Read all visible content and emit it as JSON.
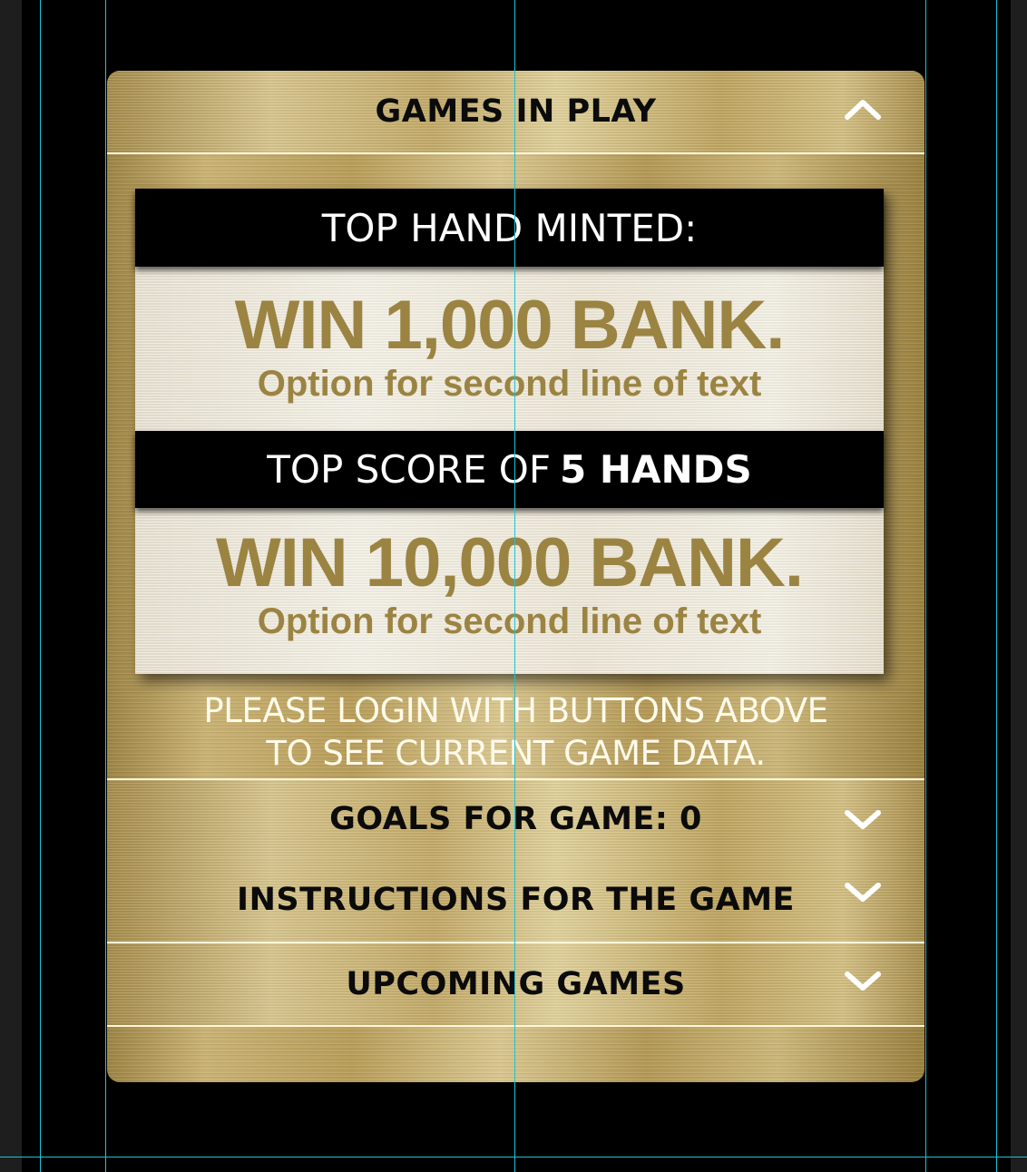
{
  "panel": {
    "header": {
      "title": "GAMES IN PLAY",
      "state": "expanded"
    },
    "prizes": [
      {
        "band_label": "TOP HAND MINTED:",
        "band_bold": "",
        "headline": "WIN 1,000 BANK.",
        "subline": "Option for second line of text"
      },
      {
        "band_label": "TOP SCORE OF",
        "band_bold": "5 HANDS",
        "headline": "WIN 10,000 BANK.",
        "subline": "Option for second line of text"
      }
    ],
    "login_message": {
      "line1": "PLEASE LOGIN WITH BUTTONS ABOVE",
      "line2": "TO SEE CURRENT GAME DATA."
    },
    "sections": [
      {
        "title": "GOALS FOR GAME: 0",
        "state": "collapsed"
      },
      {
        "title": "INSTRUCTIONS FOR THE GAME",
        "state": "collapsed"
      },
      {
        "title": "UPCOMING GAMES",
        "state": "collapsed"
      }
    ]
  },
  "colors": {
    "gold_text": "#9b8342",
    "guide": "#19c5d6",
    "band": "#000000",
    "divider": "#fff7dc"
  },
  "icons": {
    "expanded": "chevron-up-icon",
    "collapsed": "chevron-down-icon"
  }
}
